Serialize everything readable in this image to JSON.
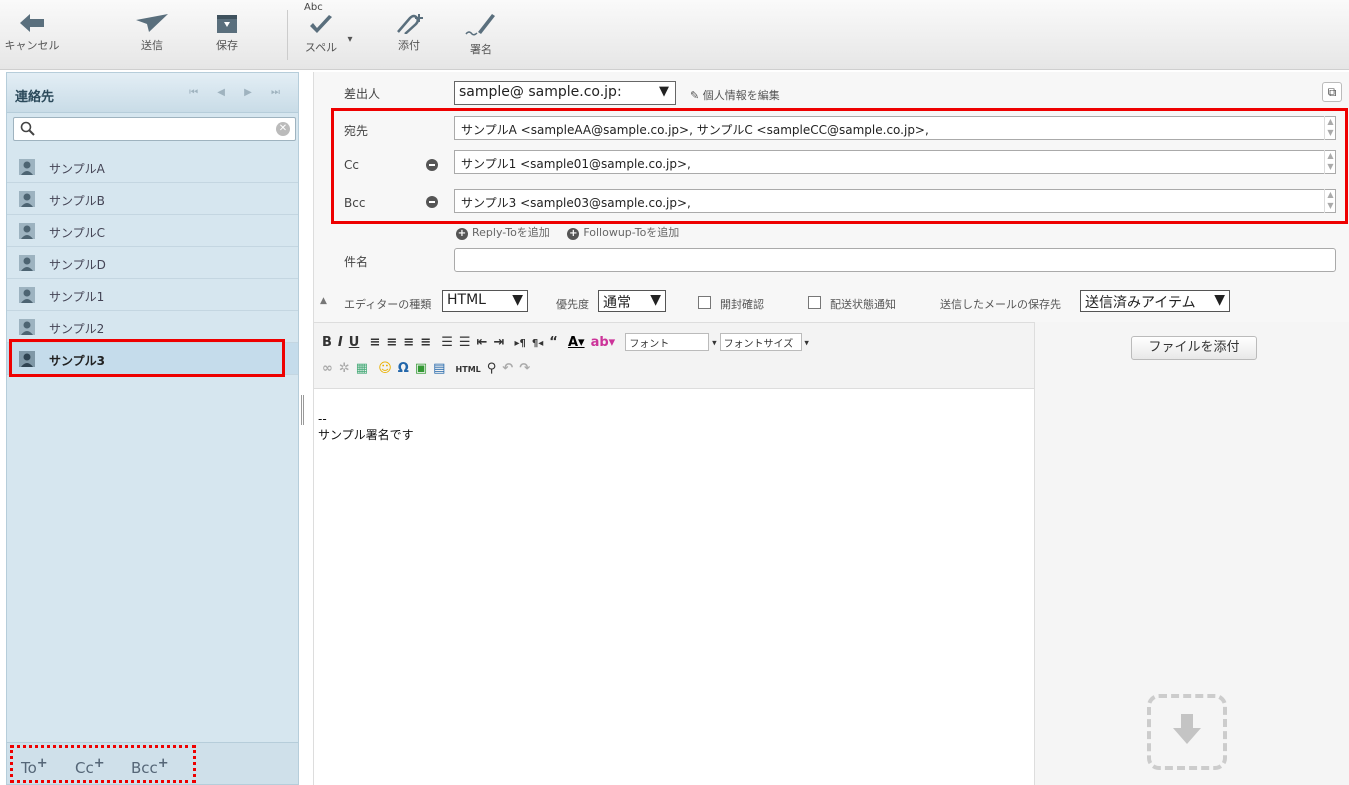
{
  "toolbar": {
    "cancel": "キャンセル",
    "send": "送信",
    "save": "保存",
    "spell": "スペル",
    "spell_badge": "Abc",
    "attach": "添付",
    "signature": "署名"
  },
  "sidebar": {
    "title": "連絡先",
    "nav": "⏮ ◀ ▶ ⏭",
    "contacts": [
      "サンプルA",
      "サンプルB",
      "サンプルC",
      "サンプルD",
      "サンプル1",
      "サンプル2",
      "サンプル3"
    ],
    "selected": "サンプル3",
    "footer": {
      "to": "To",
      "cc": "Cc",
      "bcc": "Bcc",
      "plus": "+"
    }
  },
  "compose": {
    "from_label": "差出人",
    "from_value": "sample@ sample.co.jp:",
    "edit_profile": "個人情報を編集",
    "to_label": "宛先",
    "to_value": "サンプルA <sampleAA@sample.co.jp>, サンプルC <sampleCC@sample.co.jp>,",
    "cc_label": "Cc",
    "cc_value": "サンプル1 <sample01@sample.co.jp>,",
    "bcc_label": "Bcc",
    "bcc_value": "サンプル3 <sample03@sample.co.jp>,",
    "reply_to": "Reply-Toを追加",
    "followup_to": "Followup-Toを追加",
    "subject_label": "件名",
    "subject_value": "",
    "editor_type_label": "エディターの種類",
    "editor_type_value": "HTML",
    "priority_label": "優先度",
    "priority_value": "通常",
    "read_receipt": "開封確認",
    "delivery_notice": "配送状態通知",
    "save_to_label": "送信したメールの保存先",
    "save_to_value": "送信済みアイテム"
  },
  "editor": {
    "font": "フォント",
    "font_size": "フォントサイズ",
    "body_line1": "--",
    "body_line2": "サンプル署名です"
  },
  "attachments": {
    "button": "ファイルを添付"
  },
  "colors": {
    "highlight": "#e00000",
    "sidebar_bg": "#d6e6ef"
  }
}
